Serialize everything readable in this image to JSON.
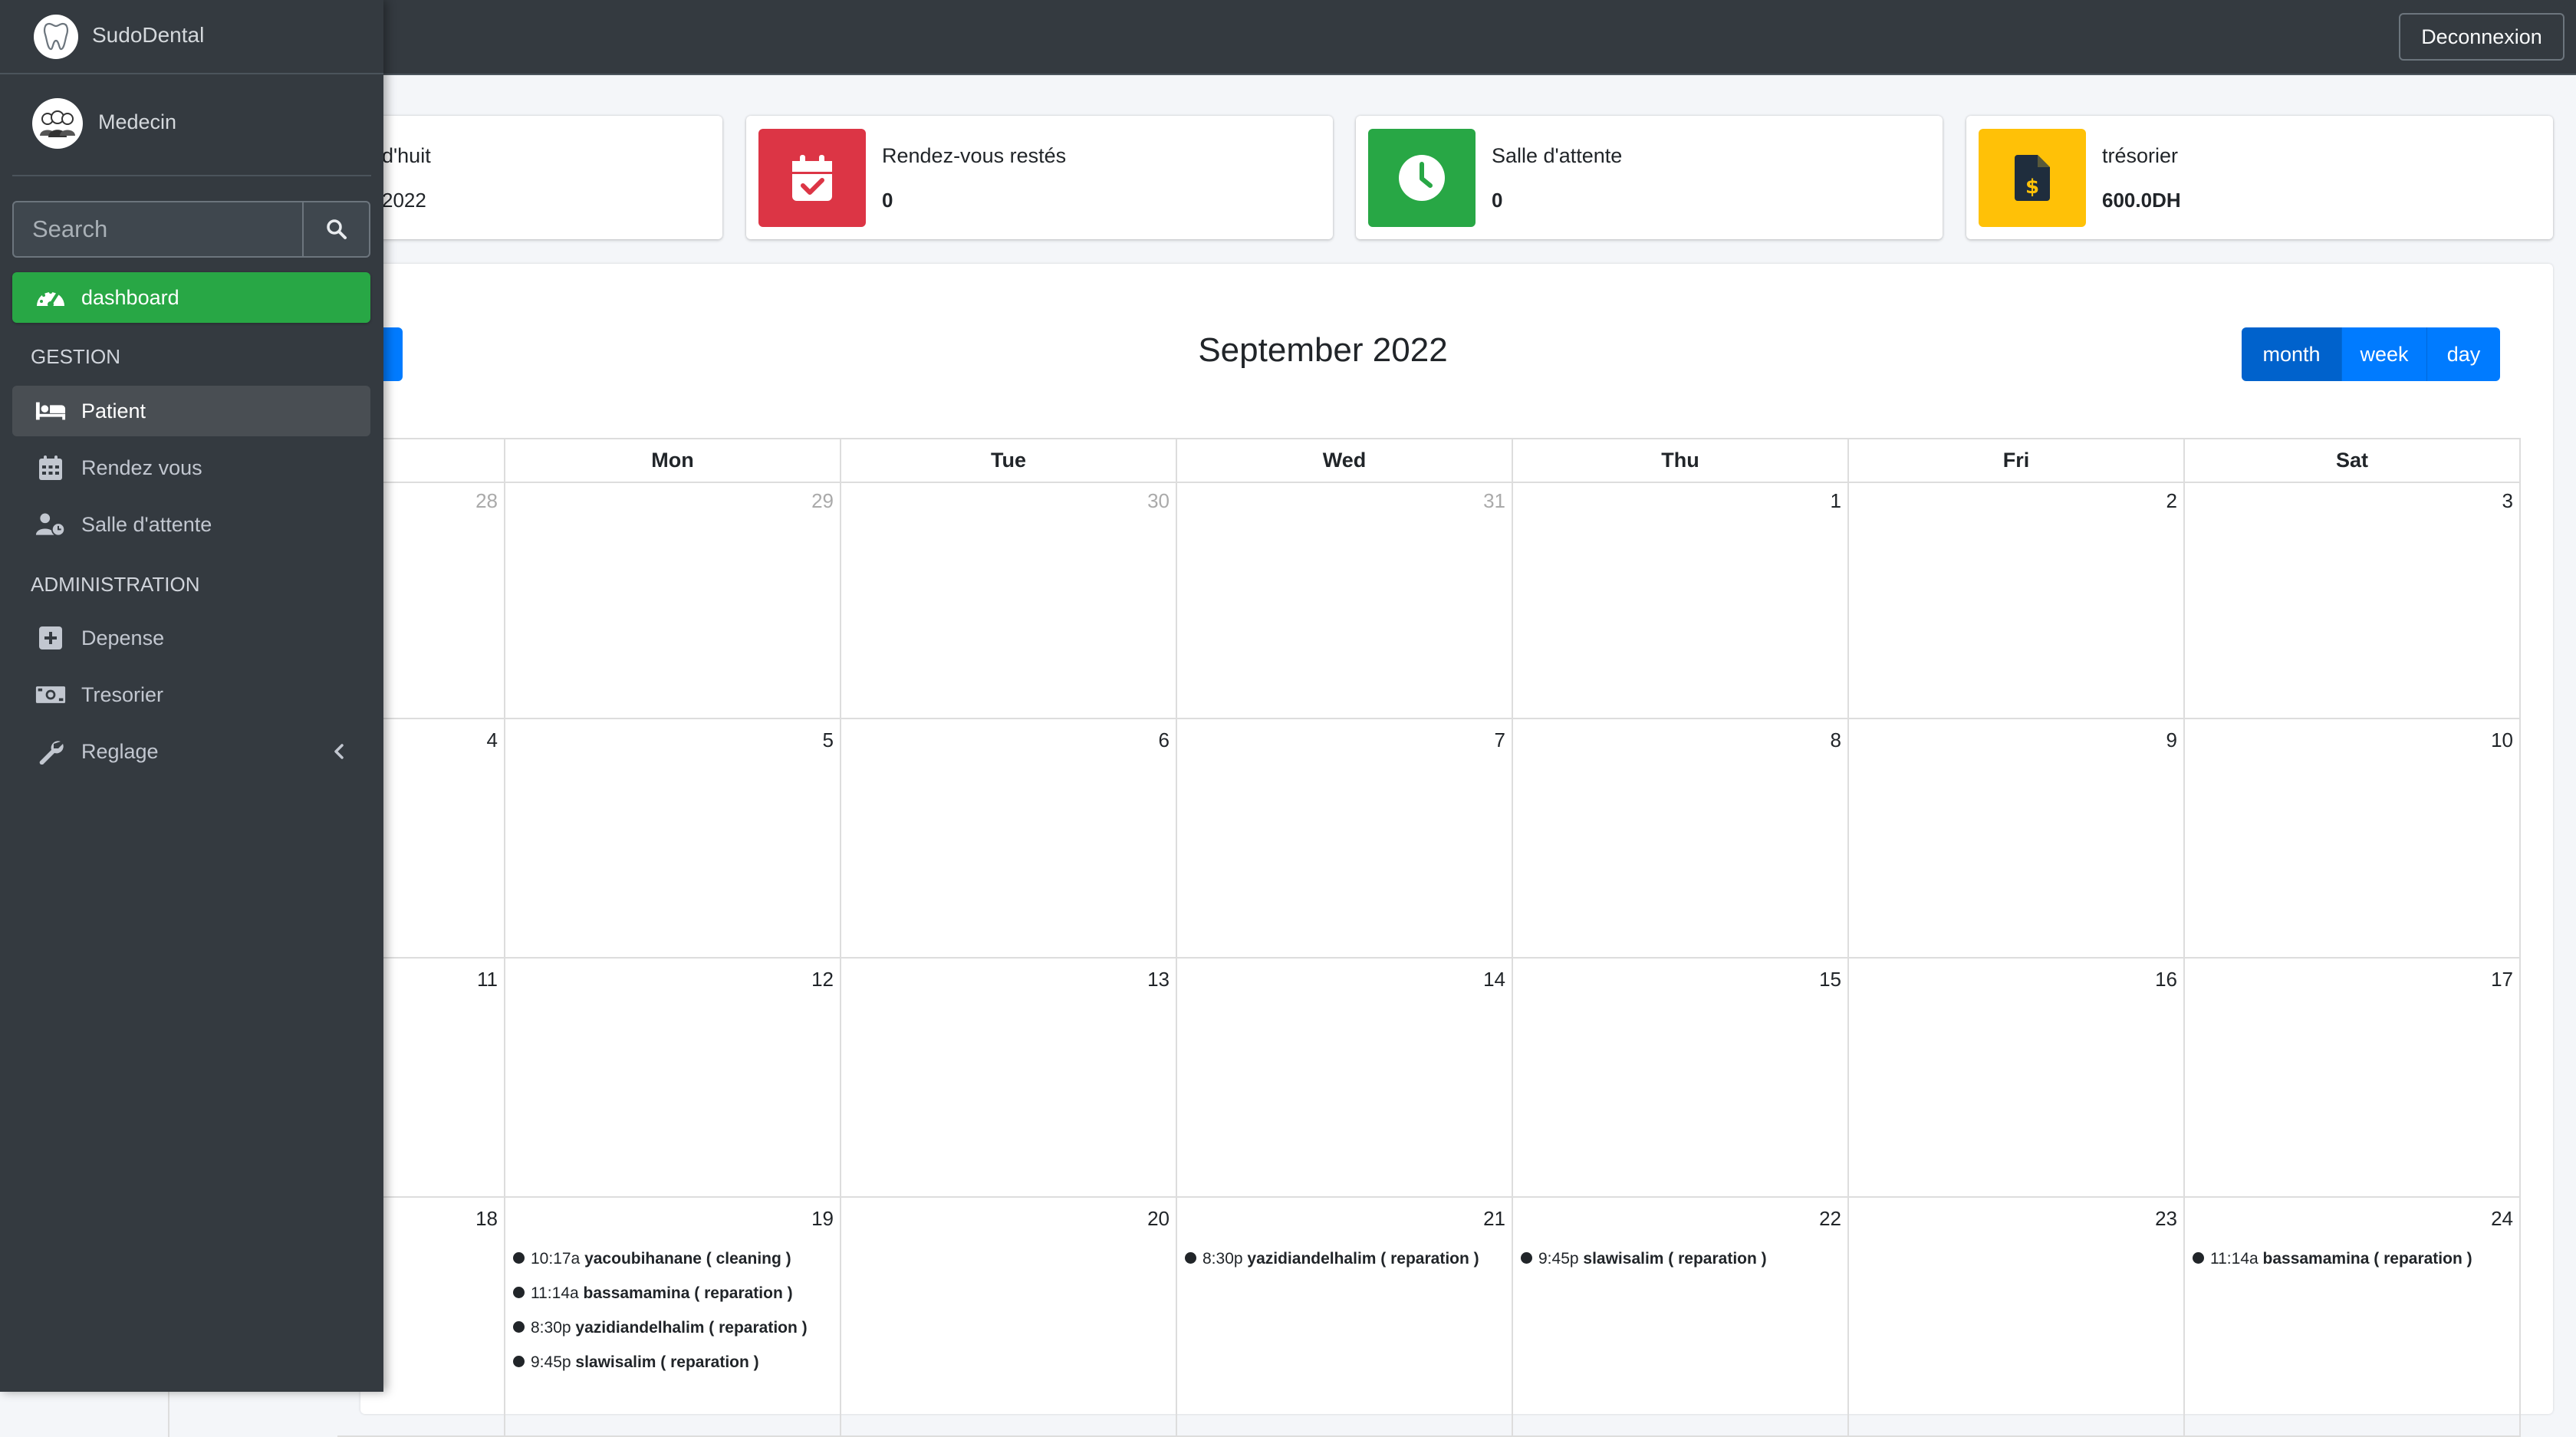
{
  "topbar": {
    "logout_label": "Deconnexion"
  },
  "sidebar": {
    "brand": "SudoDental",
    "user": "Medecin",
    "search_placeholder": "Search",
    "dashboard": "dashboard",
    "gestion_header": "GESTION",
    "admin_header": "ADMINISTRATION",
    "items": {
      "patient": "Patient",
      "rendez_vous": "Rendez vous",
      "salle": "Salle d'attente",
      "depense": "Depense",
      "tresorier": "Tresorier",
      "reglage": "Reglage"
    }
  },
  "info_boxes": [
    {
      "title": "d'huit",
      "value": "2022",
      "color": "#17a2b8"
    },
    {
      "title": "Rendez-vous restés",
      "value": "0",
      "color": "#dc3545"
    },
    {
      "title": "Salle d'attente",
      "value": "0",
      "color": "#28a745"
    },
    {
      "title": "trésorier",
      "value": "600.0DH",
      "color": "#ffc107"
    }
  ],
  "calendar": {
    "title": "September 2022",
    "views": [
      "month",
      "week",
      "day"
    ],
    "active_view": "month",
    "days_of_week": [
      "Mon",
      "Tue",
      "Wed",
      "Thu",
      "Fri",
      "Sat"
    ],
    "weeks": [
      {
        "days": [
          {
            "num": "28",
            "other": true
          },
          {
            "num": "29",
            "other": true
          },
          {
            "num": "30",
            "other": true
          },
          {
            "num": "31",
            "other": true
          },
          {
            "num": "1"
          },
          {
            "num": "2"
          },
          {
            "num": "3"
          }
        ]
      },
      {
        "days": [
          {
            "num": "4"
          },
          {
            "num": "5"
          },
          {
            "num": "6"
          },
          {
            "num": "7"
          },
          {
            "num": "8"
          },
          {
            "num": "9"
          },
          {
            "num": "10"
          }
        ]
      },
      {
        "days": [
          {
            "num": "11"
          },
          {
            "num": "12"
          },
          {
            "num": "13"
          },
          {
            "num": "14"
          },
          {
            "num": "15"
          },
          {
            "num": "16"
          },
          {
            "num": "17"
          }
        ]
      },
      {
        "days": [
          {
            "num": "18"
          },
          {
            "num": "19",
            "events": [
              {
                "time": "10:17a",
                "title": "yacoubihanane ( cleaning )"
              },
              {
                "time": "11:14a",
                "title": "bassamamina ( reparation )"
              },
              {
                "time": "8:30p",
                "title": "yazidiandelhalim ( reparation )"
              },
              {
                "time": "9:45p",
                "title": "slawisalim ( reparation )"
              }
            ]
          },
          {
            "num": "20"
          },
          {
            "num": "21",
            "events": [
              {
                "time": "8:30p",
                "title": "yazidiandelhalim ( reparation )"
              }
            ]
          },
          {
            "num": "22",
            "events": [
              {
                "time": "9:45p",
                "title": "slawisalim ( reparation )"
              }
            ]
          },
          {
            "num": "23"
          },
          {
            "num": "24",
            "events": [
              {
                "time": "11:14a",
                "title": "bassamamina ( reparation )"
              }
            ]
          }
        ]
      }
    ]
  }
}
